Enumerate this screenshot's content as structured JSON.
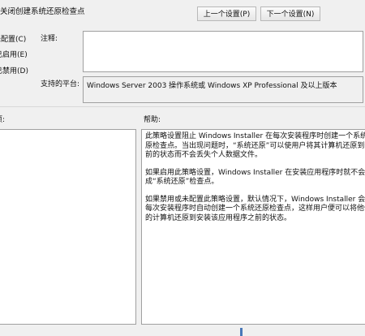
{
  "window": {
    "title": "关闭创建系统还原检查点"
  },
  "toolbar": {
    "prev_label": "上一个设置(P)",
    "next_label": "下一个设置(N)"
  },
  "state_options": {
    "not_configured": "未配置(C)",
    "enabled": "已启用(E)",
    "disabled": "已禁用(D)"
  },
  "labels": {
    "comment": "注释:",
    "supported_platform": "支持的平台:",
    "options": "项:",
    "help": "帮助:"
  },
  "fields": {
    "comment_value": "",
    "platform_value": "Windows Server 2003 操作系统或 Windows XP Professional 及以上版本"
  },
  "help_text": [
    "此策略设置阻止 Windows Installer 在每次安装程序时创建一个系统还原检查点。当出现问题时，“系统还原”可以使用户将其计算机还原到先前的状态而不会丢失个人数据文件。",
    "如果启用此策略设置，Windows Installer 在安装应用程序时就不会生成“系统还原”检查点。",
    "如果禁用或未配置此策略设置，默认情况下，Windows Installer 会在每次安装程序时自动创建一个系统还原检查点，这样用户便可以将他们的计算机还原到安装该应用程序之前的状态。"
  ]
}
